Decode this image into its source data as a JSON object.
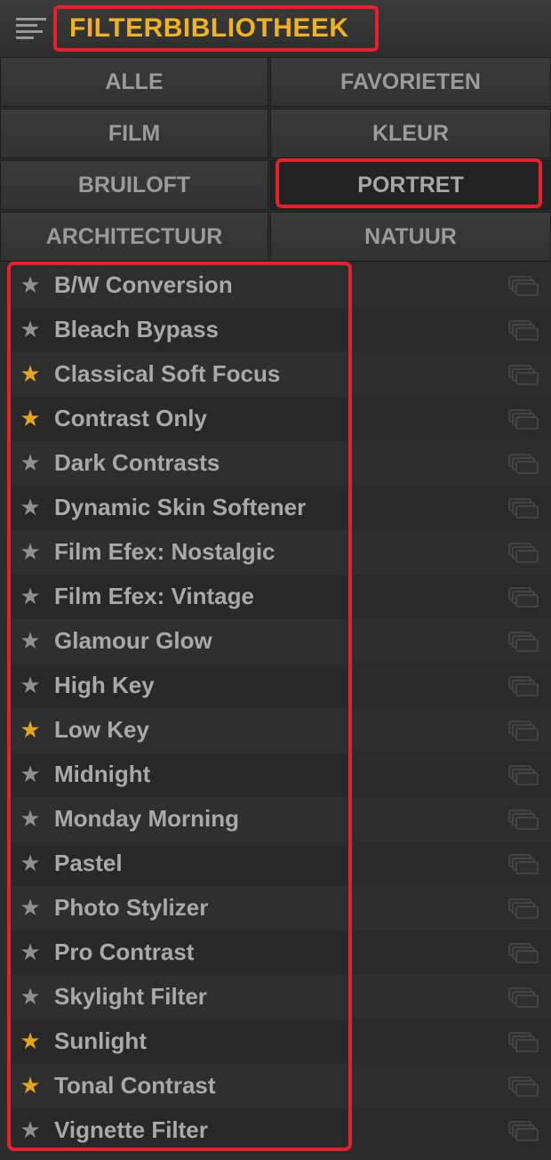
{
  "header": {
    "title": "FILTERBIBLIOTHEEK",
    "menu_icon": "list-menu-icon"
  },
  "categories": [
    {
      "label": "ALLE",
      "selected": false
    },
    {
      "label": "FAVORIETEN",
      "selected": false
    },
    {
      "label": "FILM",
      "selected": false
    },
    {
      "label": "KLEUR",
      "selected": false
    },
    {
      "label": "BRUILOFT",
      "selected": false
    },
    {
      "label": "PORTRET",
      "selected": true
    },
    {
      "label": "ARCHITECTUUR",
      "selected": false
    },
    {
      "label": "NATUUR",
      "selected": false
    }
  ],
  "filters": [
    {
      "label": "B/W Conversion",
      "favorite": false
    },
    {
      "label": "Bleach Bypass",
      "favorite": false
    },
    {
      "label": "Classical Soft Focus",
      "favorite": true
    },
    {
      "label": "Contrast Only",
      "favorite": true
    },
    {
      "label": "Dark Contrasts",
      "favorite": false
    },
    {
      "label": "Dynamic Skin Softener",
      "favorite": false
    },
    {
      "label": "Film Efex: Nostalgic",
      "favorite": false
    },
    {
      "label": "Film Efex: Vintage",
      "favorite": false
    },
    {
      "label": "Glamour Glow",
      "favorite": false
    },
    {
      "label": "High Key",
      "favorite": false
    },
    {
      "label": "Low Key",
      "favorite": true
    },
    {
      "label": "Midnight",
      "favorite": false
    },
    {
      "label": "Monday Morning",
      "favorite": false
    },
    {
      "label": "Pastel",
      "favorite": false
    },
    {
      "label": "Photo Stylizer",
      "favorite": false
    },
    {
      "label": "Pro Contrast",
      "favorite": false
    },
    {
      "label": "Skylight Filter",
      "favorite": false
    },
    {
      "label": "Sunlight",
      "favorite": true
    },
    {
      "label": "Tonal Contrast",
      "favorite": true
    },
    {
      "label": "Vignette Filter",
      "favorite": false
    }
  ],
  "colors": {
    "accent_title": "#f0b21d",
    "favorite_star": "#e2a51d",
    "default_star": "#8f8f8f",
    "annotation_red": "#e8202e"
  }
}
